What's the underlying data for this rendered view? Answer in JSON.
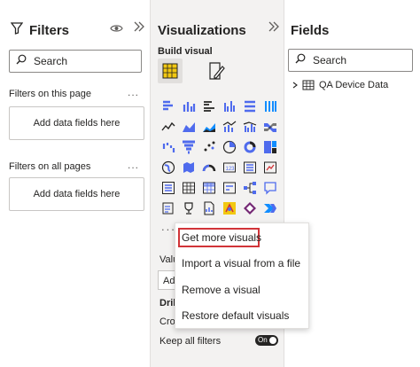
{
  "filters": {
    "title": "Filters",
    "search_placeholder": "Search",
    "page_label": "Filters on this page",
    "page_drop": "Add data fields here",
    "all_label": "Filters on all pages",
    "all_drop": "Add data fields here",
    "more_icon": "..."
  },
  "viz": {
    "title": "Visualizations",
    "build_label": "Build visual",
    "more_icon": "...",
    "values_label": "Valu",
    "add_label": "Ad",
    "drill_label": "Dril",
    "cross_label": "Cro",
    "keep_label": "Keep all filters",
    "toggle_label": "On"
  },
  "menu": {
    "items": [
      "Get more visuals",
      "Import a visual from a file",
      "Remove a visual",
      "Restore default visuals"
    ]
  },
  "fields": {
    "title": "Fields",
    "search_placeholder": "Search",
    "table_name": "QA Device Data"
  },
  "colors": {
    "accent": "#f2c811",
    "highlight_border": "#d13438",
    "icon_blue": "#4f6bed",
    "icon_teal": "#118dff"
  }
}
